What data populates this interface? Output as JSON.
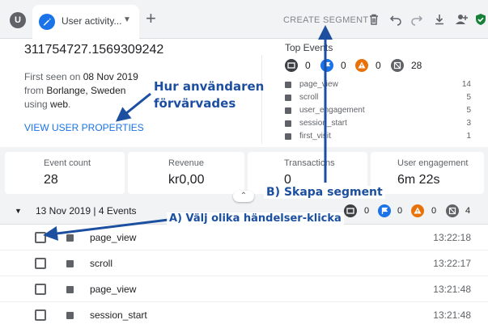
{
  "tab_bar": {
    "avatar_letter": "U",
    "tab_label": "User activity...",
    "add_tab_symbol": "+",
    "create_segment_label": "CREATE SEGMENT",
    "toolbar_icons": [
      "delete-icon",
      "undo-icon",
      "redo-icon",
      "download-icon",
      "share-icon",
      "verified-icon"
    ]
  },
  "user": {
    "user_id": "311754727.1569309242",
    "first_seen_prefix": "First seen on",
    "first_seen_date": "08 Nov 2019",
    "from_prefix": "from",
    "location": "Borlange, Sweden",
    "using_prefix": "using",
    "platform": "web",
    "view_properties_label": "VIEW USER PROPERTIES"
  },
  "top_events": {
    "title": "Top Events",
    "badges": [
      {
        "icon": "event-icon",
        "color": "#3c4043",
        "count": "0"
      },
      {
        "icon": "flag-icon",
        "color": "#1a73e8",
        "count": "0"
      },
      {
        "icon": "warning-icon",
        "color": "#e8710a",
        "count": "0"
      },
      {
        "icon": "page-icon",
        "color": "#5f6368",
        "count": "28"
      }
    ],
    "items": [
      {
        "name": "page_view",
        "count": "14"
      },
      {
        "name": "scroll",
        "count": "5"
      },
      {
        "name": "user_engagement",
        "count": "5"
      },
      {
        "name": "session_start",
        "count": "3"
      },
      {
        "name": "first_visit",
        "count": "1"
      }
    ]
  },
  "stats": [
    {
      "label": "Event count",
      "value": "28"
    },
    {
      "label": "Revenue",
      "value": "kr0,00"
    },
    {
      "label": "Transactions",
      "value": "0"
    },
    {
      "label": "User engagement",
      "value": "6m 22s"
    }
  ],
  "day": {
    "label": "13 Nov 2019 | 4 Events",
    "badges": [
      {
        "icon": "event-icon",
        "color": "#3c4043",
        "count": "0"
      },
      {
        "icon": "flag-icon",
        "color": "#1a73e8",
        "count": "0"
      },
      {
        "icon": "warning-icon",
        "color": "#e8710a",
        "count": "0"
      },
      {
        "icon": "page-icon",
        "color": "#5f6368",
        "count": "4"
      }
    ]
  },
  "events": [
    {
      "name": "page_view",
      "time": "13:22:18"
    },
    {
      "name": "scroll",
      "time": "13:22:17"
    },
    {
      "name": "page_view",
      "time": "13:21:48"
    },
    {
      "name": "session_start",
      "time": "13:21:48"
    }
  ],
  "annotations": {
    "acquisition_line1": "Hur användaren",
    "acquisition_line2": "förvärvades",
    "create_segment": "B) Skapa segment",
    "select_events": "A) Välj olika händelser-klicka"
  },
  "colors": {
    "accent": "#1a73e8",
    "annotation": "#1c4fa0",
    "warning": "#e8710a",
    "verified": "#188038"
  }
}
